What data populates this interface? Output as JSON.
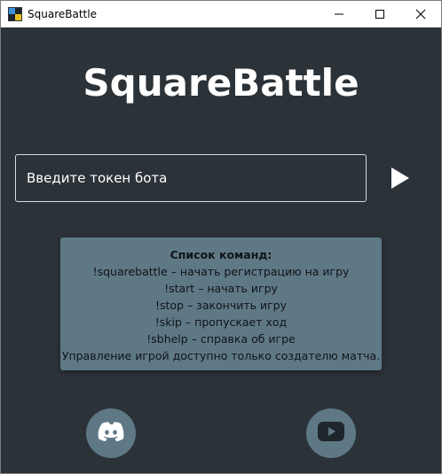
{
  "window": {
    "title": "SquareBattle",
    "app_icon": "squarebattle-app-icon",
    "controls": [
      "minimize-icon",
      "maximize-icon",
      "close-icon"
    ]
  },
  "main": {
    "app_title": "SquareBattle",
    "token_placeholder": "Введите токен бота",
    "token_value": "",
    "play_icon": "play-icon"
  },
  "help": {
    "title": "Список команд:",
    "lines": [
      "!squarebattle – начать регистрацию на игру",
      "!start – начать игру",
      "!stop – закончить игру",
      "!skip – пропускает ход",
      "!sbhelp – справка об игре",
      "Управление игрой доступно только создателю матча."
    ]
  },
  "footer": {
    "discord_icon": "discord-icon",
    "youtube_icon": "youtube-icon"
  },
  "colors": {
    "background": "#2b3238",
    "panel": "#5f7886",
    "text": "#ffffff",
    "input_border": "#d6dde2"
  }
}
